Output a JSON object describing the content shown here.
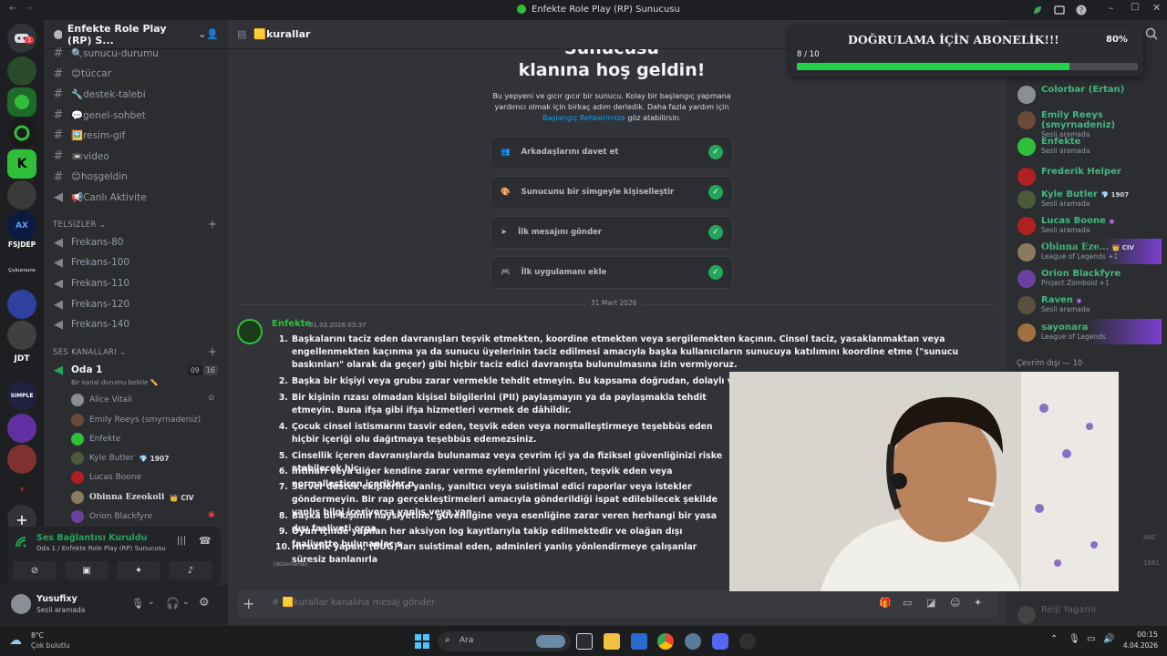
{
  "window": {
    "title": "Enfekte Role Play (RP) Sunucusu"
  },
  "server": {
    "name": "Enfekte Role Play (RP) S...",
    "tiny_label_1": "FSJDEP",
    "tiny_label_2": "JDT",
    "tiny_label_3": "SIMPLE",
    "tiny_label_4": "Çukucsuns",
    "badge": "1"
  },
  "channels": {
    "text": [
      {
        "label": "🔍sunucu-durumu"
      },
      {
        "label": "😊tüccar"
      },
      {
        "label": "🔧destek-talebi"
      },
      {
        "label": "💬genel-sohbet"
      },
      {
        "label": "🖼️resim-gif"
      },
      {
        "label": "📼video"
      },
      {
        "label": "😊hoşgeldin"
      },
      {
        "label": "📢Canlı Aktivite"
      }
    ],
    "cat_telsiz": "TELSİZLER",
    "telsiz": [
      {
        "label": "Frekans-80"
      },
      {
        "label": "Frekans-100"
      },
      {
        "label": "Frekans-110"
      },
      {
        "label": "Frekans-120"
      },
      {
        "label": "Frekans-140"
      }
    ],
    "cat_voice": "SES KANALLARI",
    "voice": {
      "label": "Oda 1",
      "count_a": "09",
      "count_b": "16",
      "status": "Bir kanal durumu belirle ✏️"
    },
    "voice_users": [
      {
        "name": "Alice Vitali",
        "color": "#8a8f96"
      },
      {
        "name": "Emily Reeys (smyrnadeniz)",
        "color": "#6a4a3a"
      },
      {
        "name": "Enfekte",
        "color": "#2fbf3a"
      },
      {
        "name": "Kyle Butler",
        "badge": "💎 1907",
        "color": "#4a5a3a"
      },
      {
        "name": "Lucas Boone",
        "color": "#b02020"
      },
      {
        "name": "Obinna Ezeokoli",
        "badge": "👑 CIV",
        "color": "#8a7a60"
      },
      {
        "name": "Orion Blackfyre",
        "color": "#6a40a0"
      }
    ]
  },
  "voice_panel": {
    "title": "Ses Bağlantısı Kuruldu",
    "sub": "Oda 1 / Enfekte Role Play (RP) Sunucusu"
  },
  "user_panel": {
    "name": "Yusufixy",
    "status": "Sesli aramada"
  },
  "main": {
    "channel": "🟨kurallar",
    "welcome_top": "Sunucusu",
    "welcome_title": "klanına hoş geldin!",
    "welcome_desc_1": "Bu yepyeni ve gıcır gıcır bir sunucu. Kolay bir başlangıç yapmana",
    "welcome_desc_2": "yardımcı olmak için birkaç adım derledik. Daha fazla yardım için",
    "welcome_link": "Başlangıç Rehberimize",
    "welcome_desc_3": " göz atabilirsin.",
    "steps": [
      {
        "label": "Arkadaşlarını davet et"
      },
      {
        "label": "Sunucunu bir simgeyle kişiselleştir"
      },
      {
        "label": "İlk mesajını gönder"
      },
      {
        "label": "İlk uygulamanı ekle"
      }
    ],
    "date_divider": "31 Mart 2026",
    "message": {
      "author": "Enfekte",
      "timestamp": "31.03.2026 03:37",
      "edited": "(düzenlendi)",
      "rules": [
        {
          "n": "1.",
          "text": "Başkalarını taciz eden davranışları teşvik etmekten, koordine etmekten veya sergilemekten kaçının. Cinsel taciz, yasaklanmaktan veya engellenmekten kaçınma ya da sunucu üyelerinin taciz edilmesi amacıyla başka kullanıcıların sunucuya katılımını koordine etme (\"sunucu baskınları\" olarak da geçer) gibi hiçbir taciz edici davranışta bulunulmasına izin vermiyoruz."
        },
        {
          "n": "2.",
          "text": "Başka bir kişiyi veya grubu zarar vermekle tehdit etmeyin. Bu kapsama doğrudan, dolaylı ve imalı tehdit"
        },
        {
          "n": "3.",
          "text": "Bir kişinin rızası olmadan kişisel bilgilerini (PII) paylaşmayın ya da paylaşmakla tehdit etmeyin. Buna ifşa gibi ifşa hizmetleri vermek de dâhildir."
        },
        {
          "n": "4.",
          "text": "Çocuk cinsel istismarını tasvir eden, teşvik eden veya normalleştirmeye teşebbüs eden hiçbir içeriği olu dağıtmaya teşebbüs edemezsiniz."
        },
        {
          "n": "5.",
          "text": "Cinsellik içeren davranışlarda bulunamaz veya çevrim içi ya da fiziksel güvenliğinizi riske atabilecek hiç"
        },
        {
          "n": "6.",
          "text": "İntiharı veya diğer kendine zarar verme eylemlerini yücelten, teşvik eden veya normalleştiren içerikler p"
        },
        {
          "n": "7.",
          "text": "Server destek ekiplerine yanlış, yanıltıcı veya suistimal edici raporlar veya istekler göndermeyin. Bir rap gerçekleştirmeleri amacıyla gönderildiği ispat edilebilecek şekilde yanlış bilgi içeriyorsa yanlış veya yan"
        },
        {
          "n": "8.",
          "text": "Başka bir kişinin haysiyetine, güvenliğine veya esenliğine zarar veren herhangi bir yasa dışı faaliyeti orga"
        },
        {
          "n": "9.",
          "text": "Oyun içinde yapılan her aksiyon log kayıtlarıyla takip edilmektedir ve olağan dışı faaliyette bulunanlar s"
        },
        {
          "n": "10.",
          "text": "Hırsızlık yapan, (BUG)'ları suistimal eden, adminleri yanlış yönlendirmeye çalışanlar süresiz banlanırla"
        }
      ]
    },
    "composer_placeholder": "🟨kurallar kanalına mesaj gönder"
  },
  "members": [
    {
      "name": "Colorbar (Ertan)",
      "status": "",
      "color": "#43b581",
      "av": "#8a8f96"
    },
    {
      "name": "Emily Reeys (smyrnadeniz)",
      "status": "Sesli aramada",
      "color": "#43b581",
      "av": "#6a4a3a"
    },
    {
      "name": "Enfekte",
      "status": "Sesli aramada",
      "color": "#43b581",
      "av": "#2fbf3a"
    },
    {
      "name": "Frederik Helper",
      "status": "",
      "color": "#43b581",
      "av": "#b02020"
    },
    {
      "name": "Kyle Butler",
      "badge": "💎 1907",
      "status": "Sesli aramada",
      "color": "#43b581",
      "av": "#4a5a3a"
    },
    {
      "name": "Lucas Boone",
      "badge": "◉",
      "status": "Sesli aramada",
      "color": "#43b581",
      "av": "#b02020"
    },
    {
      "name": "Obinna Eze...",
      "badge": "👑 CIV",
      "status": "League of Legends +1",
      "color": "#43b581",
      "av": "#8a7a60"
    },
    {
      "name": "Orion Blackfyre",
      "status": "Project Zomboid +1",
      "color": "#43b581",
      "av": "#6a40a0"
    },
    {
      "name": "Raven",
      "badge": "◉",
      "status": "Sesli aramada",
      "color": "#43b581",
      "av": "#5a5040"
    },
    {
      "name": "sayonara",
      "status": "League of Legends",
      "color": "#43b581",
      "av": "#a07040"
    }
  ],
  "offline_header": "Çevrim dışı — 10",
  "offline_member": "Reiji Yagami",
  "offline_tags": {
    "a": "ARC",
    "b": "1881"
  },
  "overlay": {
    "title": "DOĞRULAMA İÇİN ABONELİK!!!",
    "percent_label": "80%",
    "count": "8 / 10",
    "progress": 0.8
  },
  "taskbar": {
    "temp": "8°C",
    "weather": "Çok bulutlu",
    "search": "Ara",
    "time": "00:15",
    "date": "4.04.2026"
  },
  "colors": {
    "accent": "#5865f2",
    "green": "#23a55a",
    "progress": "#21d44a",
    "link": "#00a8fc"
  }
}
